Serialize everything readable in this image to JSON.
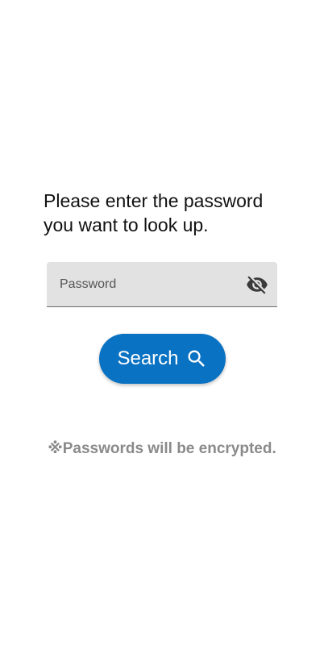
{
  "prompt": {
    "line1": "Please enter the password",
    "line2": "you want to look up."
  },
  "password_field": {
    "placeholder": "Password",
    "value": "",
    "visibility_icon": "eye-off-icon"
  },
  "search_button": {
    "label": "Search",
    "icon": "search-icon",
    "color": "#0a72c2"
  },
  "note": "※Passwords will be encrypted."
}
